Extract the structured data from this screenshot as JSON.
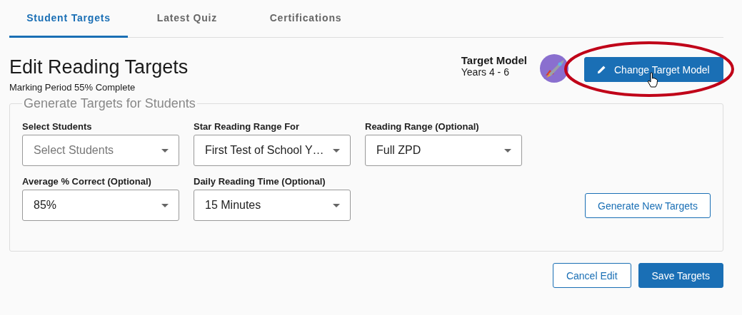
{
  "tabs": [
    {
      "label": "Student Targets",
      "selected": true
    },
    {
      "label": "Latest Quiz",
      "selected": false
    },
    {
      "label": "Certifications",
      "selected": false
    }
  ],
  "header": {
    "title": "Edit Reading Targets",
    "subtitle": "Marking Period 55% Complete",
    "model_label": "Target Model",
    "model_value": "Years 4 - 6",
    "change_button": "Change Target Model"
  },
  "generate": {
    "legend": "Generate Targets for Students",
    "fields": [
      {
        "label": "Select Students",
        "placeholder": "Select Students"
      },
      {
        "label": "Star Reading Range For",
        "value": "First Test of School Y…"
      },
      {
        "label": "Reading Range (Optional)",
        "value": "Full ZPD"
      },
      {
        "label": "Average % Correct (Optional)",
        "value": "85%"
      },
      {
        "label": "Daily Reading Time (Optional)",
        "value": "15 Minutes"
      }
    ],
    "button": "Generate New Targets"
  },
  "actions": [
    "Cancel Edit",
    "Save Targets"
  ]
}
